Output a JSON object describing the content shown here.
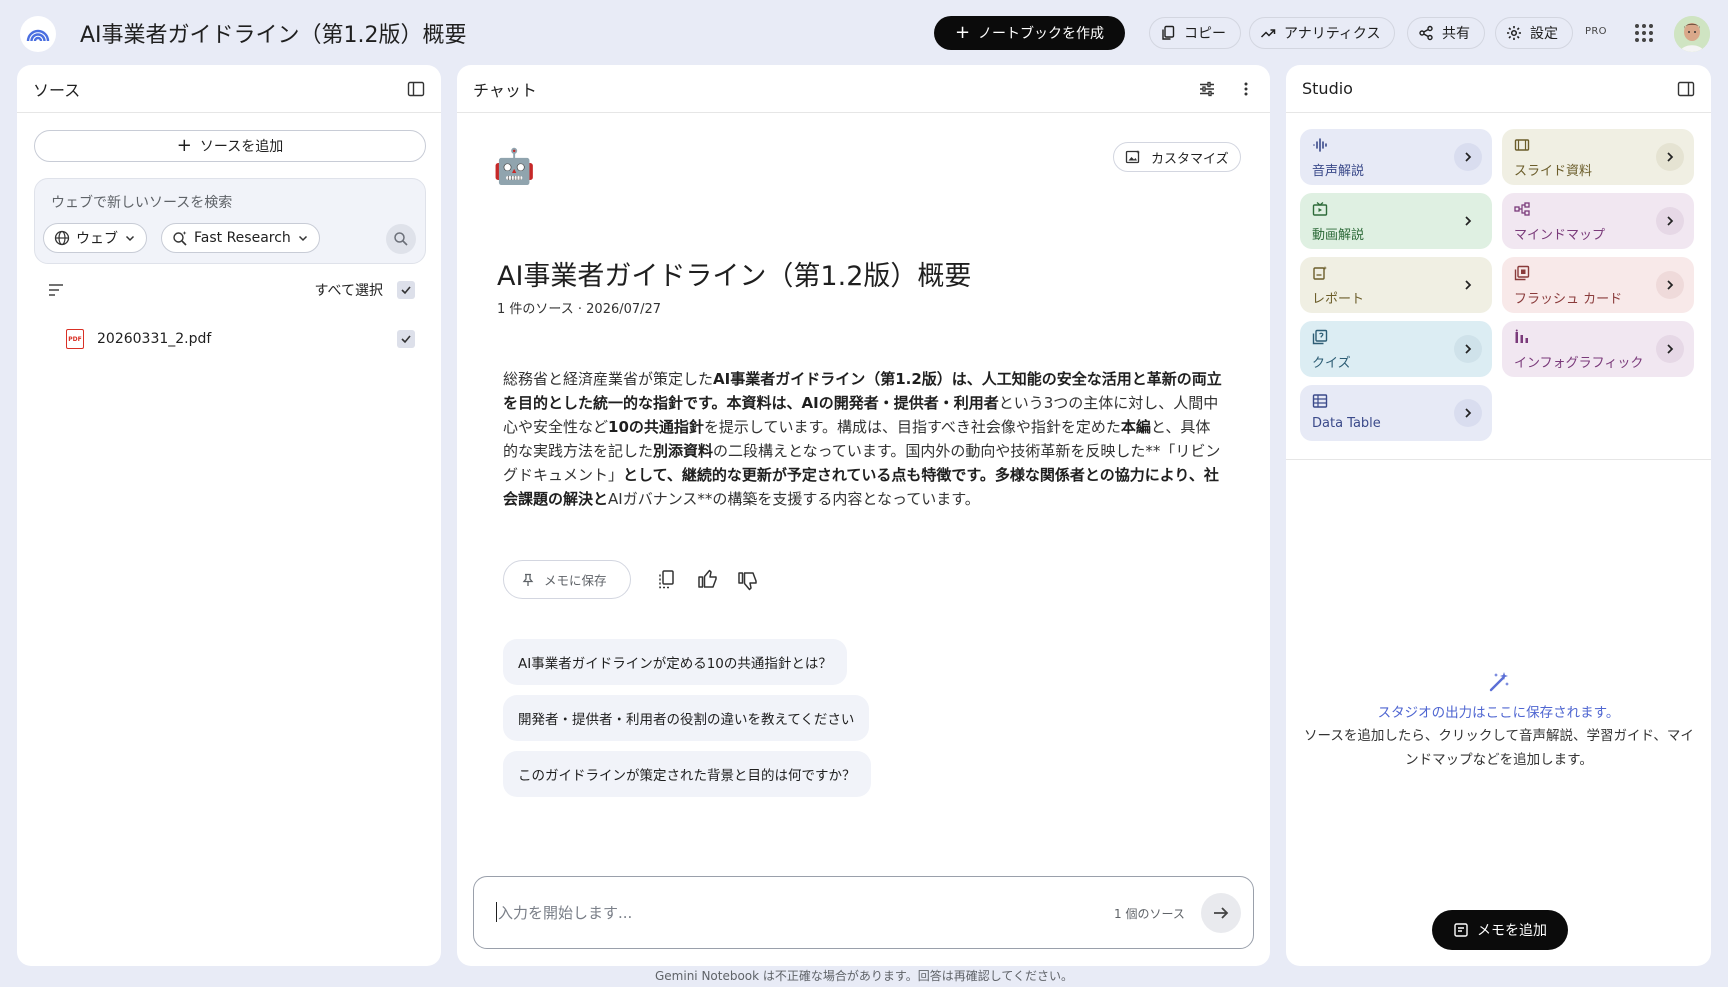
{
  "header": {
    "notebook_title": "AI事業者ガイドライン（第1.2版）概要",
    "create_notebook": "ノートブックを作成",
    "copy": "コピー",
    "analytics": "アナリティクス",
    "share": "共有",
    "settings": "設定",
    "pro_badge": "PRO"
  },
  "sources": {
    "title": "ソース",
    "add_source": "ソースを追加",
    "search_placeholder": "ウェブで新しいソースを検索",
    "web_chip": "ウェブ",
    "research_chip": "Fast Research",
    "select_all": "すべて選択",
    "files": [
      {
        "name": "20260331_2.pdf",
        "type": "PDF"
      }
    ]
  },
  "chat": {
    "title": "チャット",
    "customize": "カスタマイズ",
    "emoji": "🤖",
    "heading": "AI事業者ガイドライン（第1.2版）概要",
    "meta": "1 件のソース · 2026/07/27",
    "summary_segments": [
      {
        "t": "総務省と経済産業省が策定した",
        "b": false
      },
      {
        "t": "AI事業者ガイドライン（第1.2版）は、人工知能の安全な活用と革新の両立を目的とした統一的な指針です。本資料は、AIの開発者・提供者・利用者",
        "b": true
      },
      {
        "t": "という3つの主体に対し、人間中心や安全性など",
        "b": false
      },
      {
        "t": "10の共通指針",
        "b": true
      },
      {
        "t": "を提示しています。構成は、目指すべき社会像や指針を定めた",
        "b": false
      },
      {
        "t": "本編",
        "b": true
      },
      {
        "t": "と、具体的な実践方法を記した",
        "b": false
      },
      {
        "t": "別添資料",
        "b": true
      },
      {
        "t": "の二段構えとなっています。国内外の動向や技術革新を反映した**「リビングドキュメント」",
        "b": false
      },
      {
        "t": "として、継続的な更新が予定されている点も特徴です。多様な関係者との協力により、社会課題の解決と",
        "b": true
      },
      {
        "t": "AIガバナンス**の構築を支援する内容となっています。",
        "b": false
      }
    ],
    "save_memo": "メモに保存",
    "suggestions": [
      "AI事業者ガイドラインが定める10の共通指針とは？",
      "開発者・提供者・利用者の役割の違いを教えてください",
      "このガイドラインが策定された背景と目的は何ですか？"
    ],
    "input_placeholder": "入力を開始します...",
    "source_count": "1 個のソース",
    "disclaimer": "Gemini Notebook は不正確な場合があります。回答は再確認してください。"
  },
  "studio": {
    "title": "Studio",
    "tiles": [
      {
        "label": "音声解説",
        "icon": "audio-wave-icon",
        "bg": "#e7eaf6",
        "fg": "#3b4a8a",
        "btn": "#d9ddef"
      },
      {
        "label": "スライド資料",
        "icon": "slides-icon",
        "bg": "#f0efe3",
        "fg": "#6b5d2a",
        "btn": "#e5e3d2"
      },
      {
        "label": "動画解説",
        "icon": "video-icon",
        "bg": "#dff0e2",
        "fg": "#2e6b3a",
        "btn": "#dff0e2"
      },
      {
        "label": "マインドマップ",
        "icon": "mindmap-icon",
        "bg": "#f1e7f1",
        "fg": "#7a3a7a",
        "btn": "#e6d8e6"
      },
      {
        "label": "レポート",
        "icon": "report-icon",
        "bg": "#f0efe3",
        "fg": "#6b5d2a",
        "btn": "#f0efe3"
      },
      {
        "label": "フラッシュ カード",
        "icon": "flashcard-icon",
        "bg": "#f8e9e9",
        "fg": "#8a3b3b",
        "btn": "#efdada"
      },
      {
        "label": "クイズ",
        "icon": "quiz-icon",
        "bg": "#dcedf3",
        "fg": "#2d5d74",
        "btn": "#cfe2ea"
      },
      {
        "label": "インフォグラフィック",
        "icon": "infographic-icon",
        "bg": "#f1e7f1",
        "fg": "#7a3a7a",
        "btn": "#e6d8e6"
      },
      {
        "label": "Data Table",
        "icon": "table-icon",
        "bg": "#e7eaf6",
        "fg": "#3b4a8a",
        "btn": "#d9ddef"
      }
    ],
    "empty_title": "スタジオの出力はここに保存されます。",
    "empty_desc": "ソースを追加したら、クリックして音声解説、学習ガイド、マインドマップなどを追加します。",
    "add_memo": "メモを追加"
  }
}
